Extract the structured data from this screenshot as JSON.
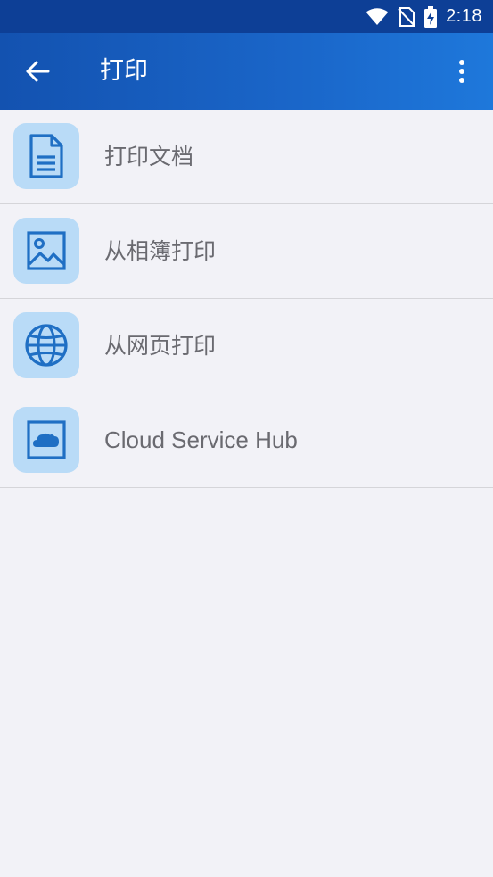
{
  "status_bar": {
    "time": "2:18",
    "icons": [
      "wifi-icon",
      "no-sim-icon",
      "battery-charging-icon"
    ]
  },
  "app_bar": {
    "title": "打印",
    "back_icon": "arrow-left-icon",
    "more_icon": "more-vertical-icon"
  },
  "menu": {
    "items": [
      {
        "label": "打印文档",
        "icon": "document-icon"
      },
      {
        "label": "从相簿打印",
        "icon": "image-icon"
      },
      {
        "label": "从网页打印",
        "icon": "globe-icon"
      },
      {
        "label": "Cloud Service Hub",
        "icon": "cloud-icon"
      }
    ]
  },
  "colors": {
    "status_bar": "#0d3f96",
    "app_bar": "#1a66c9",
    "icon_tile": "#b9dbf7",
    "icon_stroke": "#1f6fc4",
    "label_text": "#6a6a70",
    "background": "#f2f2f7"
  }
}
